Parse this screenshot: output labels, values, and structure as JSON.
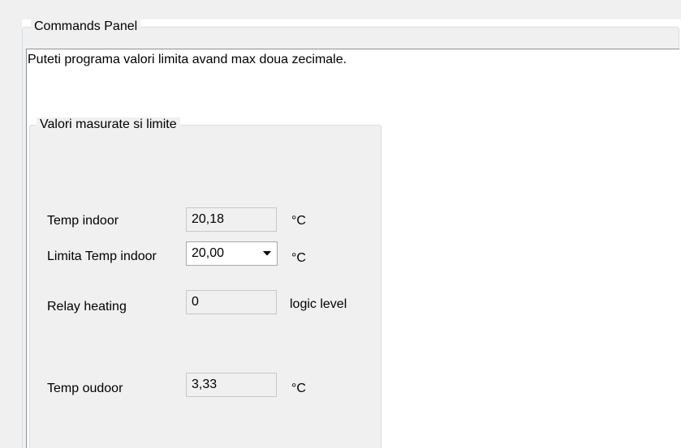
{
  "commands_panel": {
    "title": "Commands Panel",
    "info_text": "Puteti programa valori limita avand max doua zecimale."
  },
  "values_group": {
    "title": "Valori masurate si limite",
    "rows": {
      "temp_indoor": {
        "label": "Temp indoor",
        "value": "20,18",
        "unit": "°C"
      },
      "limit_temp_indoor": {
        "label": "Limita Temp indoor",
        "value": "20,00",
        "unit": "°C"
      },
      "relay_heating": {
        "label": "Relay heating",
        "value": "0",
        "unit": "logic level"
      },
      "temp_outdoor": {
        "label": "Temp oudoor",
        "value": "3,33",
        "unit": "°C"
      }
    }
  },
  "icons": {
    "dropdown": "chevron-down-icon"
  },
  "colors": {
    "panel_background": "#f0f0f0",
    "content_background": "#ffffff",
    "group_border": "#d5dfe5",
    "readonly_box_border": "#c8c8c8"
  }
}
